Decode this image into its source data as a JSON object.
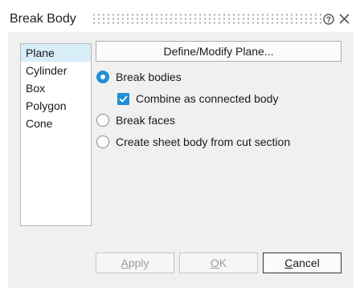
{
  "dialog": {
    "title": "Break Body",
    "help_icon": "help-circle-icon",
    "close_icon": "close-icon"
  },
  "methods": [
    {
      "label": "Plane",
      "selected": true
    },
    {
      "label": "Cylinder",
      "selected": false
    },
    {
      "label": "Box",
      "selected": false
    },
    {
      "label": "Polygon",
      "selected": false
    },
    {
      "label": "Cone",
      "selected": false
    }
  ],
  "define_button": "Define/Modify Plane...",
  "options": {
    "break_bodies": {
      "label": "Break bodies",
      "selected": true
    },
    "combine": {
      "label": "Combine as connected body",
      "checked": true
    },
    "break_faces": {
      "label": "Break faces",
      "selected": false
    },
    "sheet_body": {
      "label": "Create sheet body from cut section",
      "selected": false
    }
  },
  "footer": {
    "apply": {
      "label": "Apply",
      "mnemonic": "A",
      "rest": "pply",
      "enabled": false
    },
    "ok": {
      "label": "OK",
      "mnemonic": "O",
      "rest": "K",
      "enabled": false
    },
    "cancel": {
      "label": "Cancel",
      "mnemonic": "C",
      "rest": "ancel",
      "enabled": true
    }
  },
  "colors": {
    "accent": "#1f8fd6",
    "selection": "#d8eef9",
    "panel": "#f0f0f0"
  }
}
